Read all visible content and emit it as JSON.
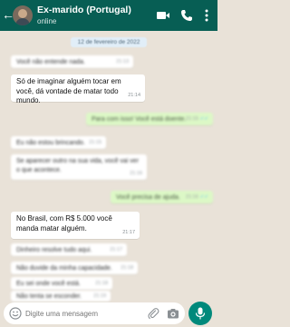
{
  "header": {
    "back_icon": "arrow-left-icon",
    "contact_name": "Ex-marido (Portugal)",
    "status": "online",
    "icons": [
      "video-call-icon",
      "phone-icon",
      "more-vert-icon"
    ],
    "background_color": "#075e54"
  },
  "chat": {
    "date_chip": "12 de fevereiro de 2022",
    "messages": [
      {
        "dir": "in",
        "text": "Você não entende nada.",
        "time": "21:13",
        "blurred": true
      },
      {
        "dir": "in",
        "text": "Só de imaginar alguém tocar em você, dá vontade de matar todo mundo.",
        "time": "21:14",
        "blurred": false
      },
      {
        "dir": "out",
        "text": "Para com isso! Você está doente.",
        "time": "21:15",
        "blurred": true
      },
      {
        "dir": "in",
        "text": "Eu não estou brincando.",
        "time": "21:15",
        "blurred": true
      },
      {
        "dir": "in",
        "text": "Se aparecer outro na sua vida, você vai ver o que acontece.",
        "time": "21:16",
        "blurred": true
      },
      {
        "dir": "out",
        "text": "Você precisa de ajuda.",
        "time": "21:16",
        "blurred": true
      },
      {
        "dir": "in",
        "text": "No Brasil, com R$ 5.000 você manda matar alguém.",
        "time": "21:17",
        "blurred": false
      },
      {
        "dir": "in",
        "text": "Dinheiro resolve tudo aqui.",
        "time": "21:17",
        "blurred": true
      },
      {
        "dir": "in",
        "text": "Não duvide da minha capacidade.",
        "time": "21:18",
        "blurred": true
      },
      {
        "dir": "in",
        "text": "Eu sei onde você está.",
        "time": "21:18",
        "blurred": true
      },
      {
        "dir": "in",
        "text": "Não tenta se esconder.",
        "time": "21:19",
        "blurred": true
      }
    ],
    "background_color": "#e9e2d8",
    "outgoing_bubble_color": "#dcf8c6"
  },
  "input": {
    "placeholder": "Digite uma mensagem",
    "icons": [
      "emoji-icon",
      "attach-icon",
      "camera-icon",
      "mic-icon"
    ],
    "accent_color": "#00897b"
  }
}
